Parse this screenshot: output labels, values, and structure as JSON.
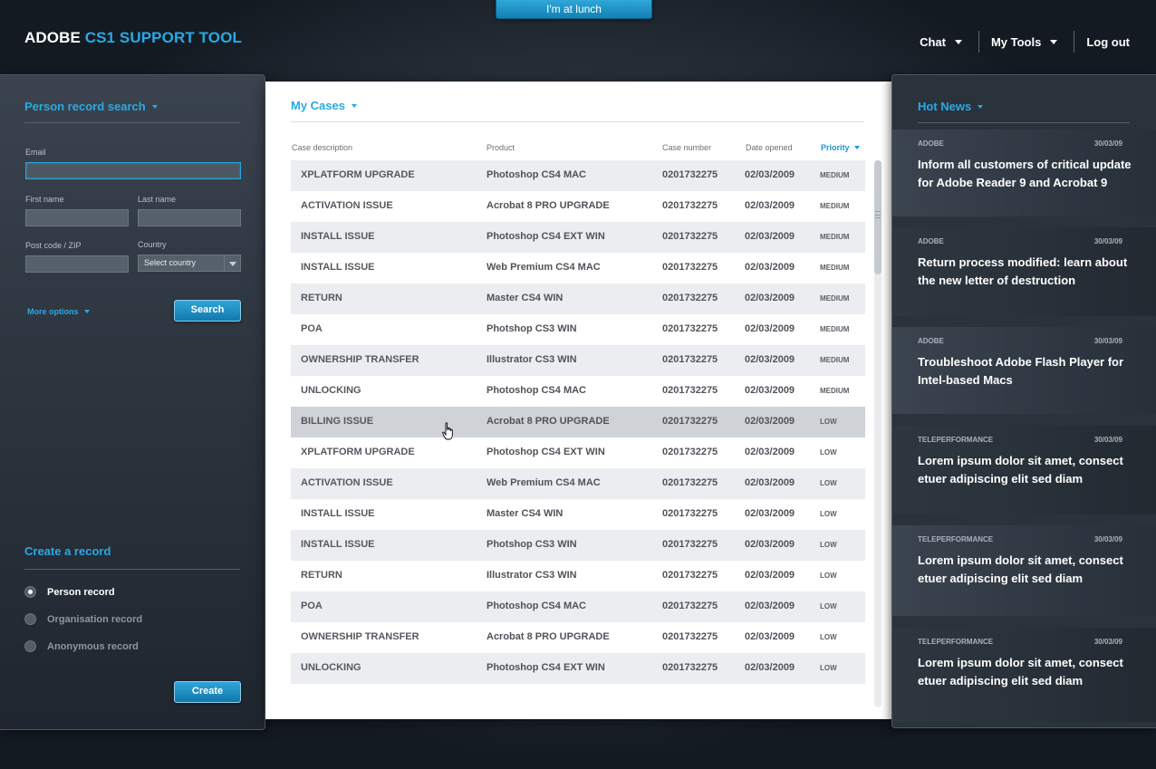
{
  "lunch_button": "I'm at lunch",
  "app": {
    "title_prefix": "ADOBE",
    "title_accent": "CS1 SUPPORT TOOL"
  },
  "topnav": {
    "chat": "Chat",
    "my_tools": "My Tools",
    "logout": "Log out"
  },
  "person_search": {
    "title": "Person record search",
    "email_label": "Email",
    "email_value": "",
    "first_name_label": "First name",
    "last_name_label": "Last name",
    "postcode_label": "Post code / ZIP",
    "country_label": "Country",
    "country_value": "Select country",
    "more_options": "More options",
    "search_button": "Search"
  },
  "create_record": {
    "title": "Create a record",
    "options": [
      "Person record",
      "Organisation record",
      "Anonymous record"
    ],
    "selected": "Person record",
    "create_button": "Create"
  },
  "cases": {
    "title": "My Cases",
    "columns": [
      "Case description",
      "Product",
      "Case number",
      "Date opened",
      "Priority"
    ],
    "rows": [
      [
        "XPLATFORM UPGRADE",
        "Photoshop CS4 MAC",
        "0201732275",
        "02/03/2009",
        "MEDIUM"
      ],
      [
        "ACTIVATION ISSUE",
        "Acrobat 8 PRO UPGRADE",
        "0201732275",
        "02/03/2009",
        "MEDIUM"
      ],
      [
        "INSTALL ISSUE",
        "Photoshop CS4 EXT WIN",
        "0201732275",
        "02/03/2009",
        "MEDIUM"
      ],
      [
        "INSTALL ISSUE",
        "Web Premium CS4 MAC",
        "0201732275",
        "02/03/2009",
        "MEDIUM"
      ],
      [
        "RETURN",
        "Master CS4 WIN",
        "0201732275",
        "02/03/2009",
        "MEDIUM"
      ],
      [
        "POA",
        "Photshop CS3 WIN",
        "0201732275",
        "02/03/2009",
        "MEDIUM"
      ],
      [
        "OWNERSHIP TRANSFER",
        "Illustrator CS3 WIN",
        "0201732275",
        "02/03/2009",
        "MEDIUM"
      ],
      [
        "UNLOCKING",
        "Photoshop CS4 MAC",
        "0201732275",
        "02/03/2009",
        "MEDIUM"
      ],
      [
        "BILLING ISSUE",
        "Acrobat 8 PRO UPGRADE",
        "0201732275",
        "02/03/2009",
        "LOW"
      ],
      [
        "XPLATFORM UPGRADE",
        "Photoshop CS4 EXT WIN",
        "0201732275",
        "02/03/2009",
        "LOW"
      ],
      [
        "ACTIVATION ISSUE",
        "Web Premium CS4 MAC",
        "0201732275",
        "02/03/2009",
        "LOW"
      ],
      [
        "INSTALL ISSUE",
        "Master CS4 WIN",
        "0201732275",
        "02/03/2009",
        "LOW"
      ],
      [
        "INSTALL ISSUE",
        "Photshop CS3 WIN",
        "0201732275",
        "02/03/2009",
        "LOW"
      ],
      [
        "RETURN",
        "Illustrator CS3 WIN",
        "0201732275",
        "02/03/2009",
        "LOW"
      ],
      [
        "POA",
        "Photoshop CS4 MAC",
        "0201732275",
        "02/03/2009",
        "LOW"
      ],
      [
        "OWNERSHIP TRANSFER",
        "Acrobat 8 PRO UPGRADE",
        "0201732275",
        "02/03/2009",
        "LOW"
      ],
      [
        "UNLOCKING",
        "Photoshop CS4 EXT WIN",
        "0201732275",
        "02/03/2009",
        "LOW"
      ]
    ],
    "hovered_row": 8
  },
  "hot_news": {
    "title": "Hot News",
    "items": [
      {
        "source": "ADOBE",
        "date": "30/03/09",
        "headline": "Inform all customers of critical update for Adobe Reader 9 and Acrobat 9"
      },
      {
        "source": "ADOBE",
        "date": "30/03/09",
        "headline": "Return process modified: learn about the new letter of destruction"
      },
      {
        "source": "ADOBE",
        "date": "30/03/09",
        "headline": "Troubleshoot Adobe Flash Player for Intel-based Macs"
      },
      {
        "source": "TELEPERFORMANCE",
        "date": "30/03/09",
        "headline": "Lorem ipsum dolor sit amet, consect etuer adipiscing elit sed diam"
      },
      {
        "source": "TELEPERFORMANCE",
        "date": "30/03/09",
        "headline": "Lorem ipsum dolor sit amet, consect etuer adipiscing elit sed diam"
      },
      {
        "source": "TELEPERFORMANCE",
        "date": "30/03/09",
        "headline": "Lorem ipsum dolor sit amet, consect etuer adipiscing elit sed diam"
      }
    ]
  },
  "colors": {
    "accent": "#29a9e4",
    "button": "#1a8cc4"
  }
}
